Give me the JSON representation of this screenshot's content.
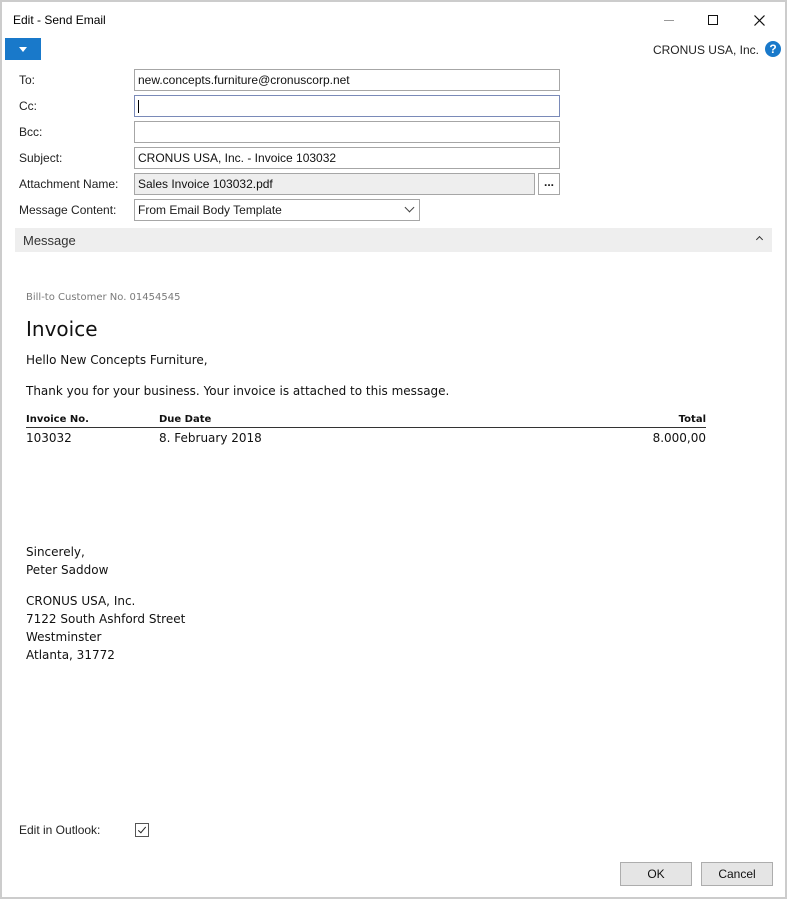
{
  "window": {
    "title": "Edit - Send Email",
    "company": "CRONUS USA, Inc.",
    "help_glyph": "?"
  },
  "form": {
    "to_label": "To:",
    "to_value": "new.concepts.furniture@cronuscorp.net",
    "cc_label": "Cc:",
    "cc_value": "",
    "bcc_label": "Bcc:",
    "bcc_value": "",
    "subject_label": "Subject:",
    "subject_value": "CRONUS USA, Inc. - Invoice 103032",
    "attachment_label": "Attachment Name:",
    "attachment_value": "Sales Invoice 103032.pdf",
    "assist_label": "...",
    "content_label": "Message Content:",
    "content_value": "From Email Body Template"
  },
  "section": {
    "title": "Message"
  },
  "message": {
    "bill_to": "Bill-to Customer No. 01454545",
    "heading": "Invoice",
    "greeting": "Hello New Concepts Furniture,",
    "thanks": "Thank you for your business. Your invoice is attached to this message.",
    "table": {
      "headers": [
        "Invoice No.",
        "Due Date",
        "Total"
      ],
      "row": [
        "103032",
        "8. February 2018",
        "8.000,00"
      ]
    },
    "closing": "Sincerely,",
    "signer": "Peter Saddow",
    "address": [
      "CRONUS USA, Inc.",
      "7122 South Ashford Street",
      "Westminster",
      "Atlanta, 31772"
    ]
  },
  "footer": {
    "outlook_label": "Edit in Outlook:",
    "outlook_checked": true,
    "ok_label": "OK",
    "cancel_label": "Cancel"
  }
}
